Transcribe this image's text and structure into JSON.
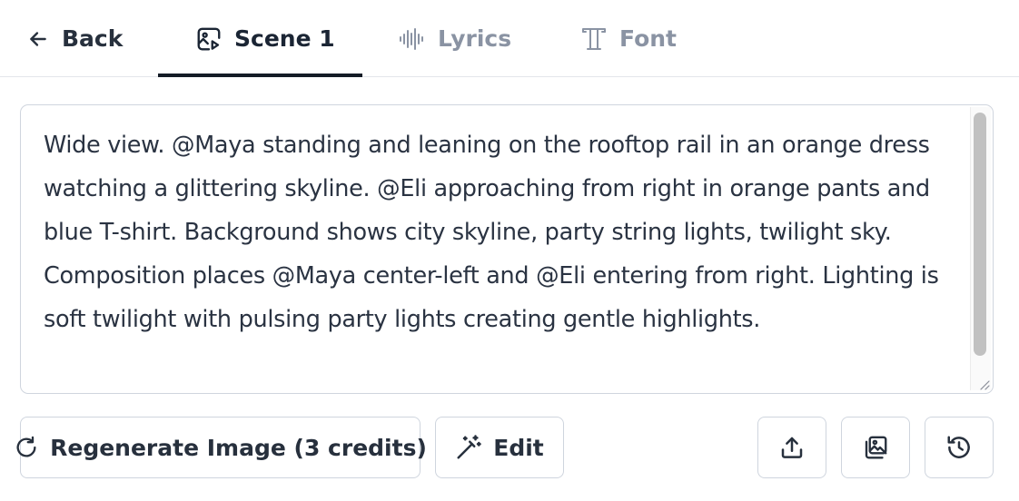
{
  "tabs": {
    "back_label": "Back",
    "scene_label": "Scene 1",
    "lyrics_label": "Lyrics",
    "font_label": "Font",
    "active": "Scene 1"
  },
  "prompt": {
    "text": "Wide view. @Maya standing and leaning on the rooftop rail in an orange dress watching a glittering skyline. @Eli approaching from right in orange pants and blue T-shirt. Background shows city skyline, party string lights, twilight sky. Composition places @Maya center-left and @Eli entering from right. Lighting is soft twilight with pulsing party lights creating gentle highlights."
  },
  "actions": {
    "regenerate_label": "Regenerate Image (3 credits)",
    "edit_label": "Edit"
  },
  "icons": {
    "back": "arrow-left-icon",
    "scene": "image-play-icon",
    "lyrics": "audio-waveform-icon",
    "font": "type-icon",
    "regenerate": "rotate-cw-icon",
    "edit": "magic-wand-icon",
    "upload": "upload-icon",
    "gallery": "images-icon",
    "history": "history-icon"
  },
  "colors": {
    "active_text": "#1b2534",
    "inactive_text": "#8a93a3",
    "border": "#cfd5de",
    "underline": "#141b26"
  }
}
